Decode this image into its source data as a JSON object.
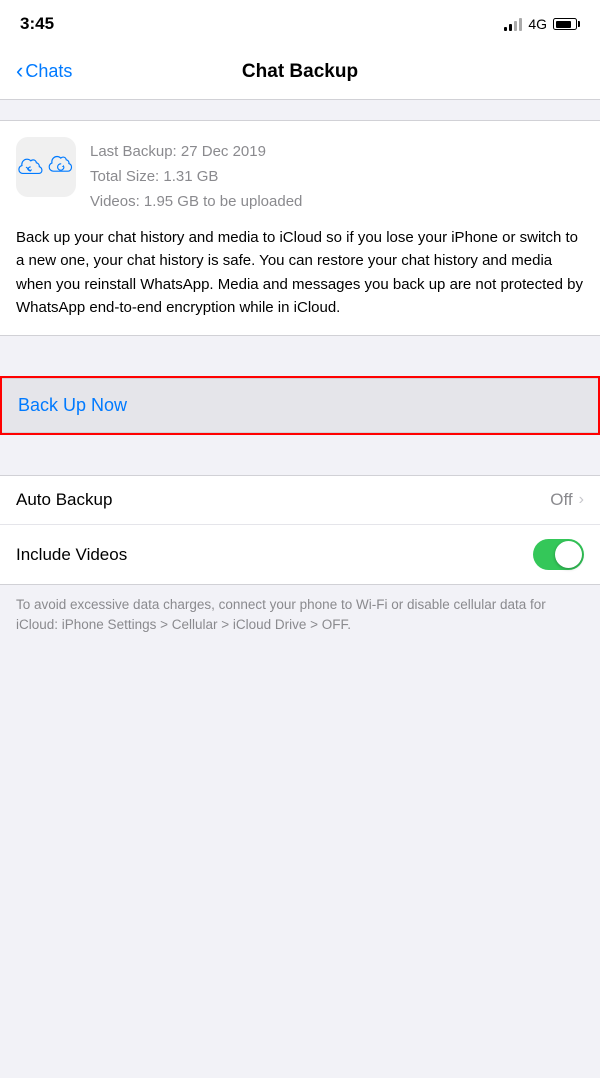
{
  "statusBar": {
    "time": "3:45",
    "network": "4G"
  },
  "navigation": {
    "backLabel": "Chats",
    "title": "Chat Backup"
  },
  "backup": {
    "lastBackup": "Last Backup: 27 Dec 2019",
    "totalSize": "Total Size: 1.31 GB",
    "videos": "Videos: 1.95 GB to be uploaded",
    "description": "Back up your chat history and media to iCloud so if you lose your iPhone or switch to a new one, your chat history is safe. You can restore your chat history and media when you reinstall WhatsApp. Media and messages you back up are not protected by WhatsApp end-to-end encryption while in iCloud."
  },
  "buttons": {
    "backUpNow": "Back Up Now"
  },
  "settings": {
    "autoBackup": {
      "label": "Auto Backup",
      "value": "Off"
    },
    "includeVideos": {
      "label": "Include Videos",
      "enabled": true
    }
  },
  "footerNote": "To avoid excessive data charges, connect your phone to Wi-Fi or disable cellular data for iCloud: iPhone Settings > Cellular > iCloud Drive > OFF."
}
